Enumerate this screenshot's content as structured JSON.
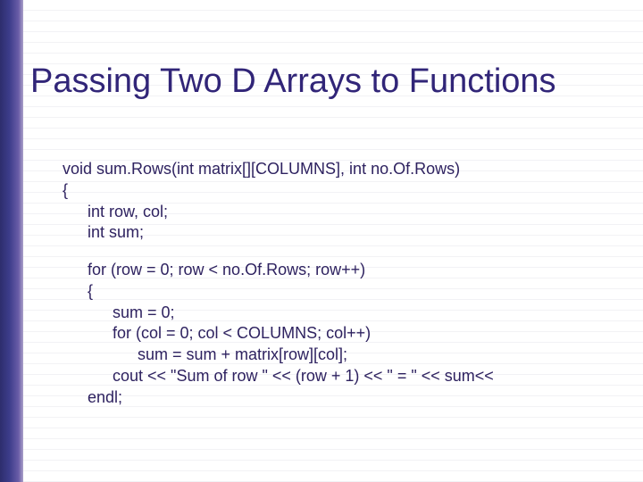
{
  "title": "Passing Two D Arrays to Functions",
  "code": {
    "l1": "void sum.Rows(int matrix[][COLUMNS], int no.Of.Rows)",
    "l2": "{",
    "l3": "int row, col;",
    "l4": "int sum;",
    "l5": "for (row = 0; row < no.Of.Rows; row++)",
    "l6": "{",
    "l7": "sum = 0;",
    "l8": "for (col = 0; col < COLUMNS; col++)",
    "l9": "sum = sum + matrix[row][col];",
    "l10": "cout << \"Sum of row \" << (row + 1) << \" = \" << sum<<",
    "l11": "endl;"
  }
}
